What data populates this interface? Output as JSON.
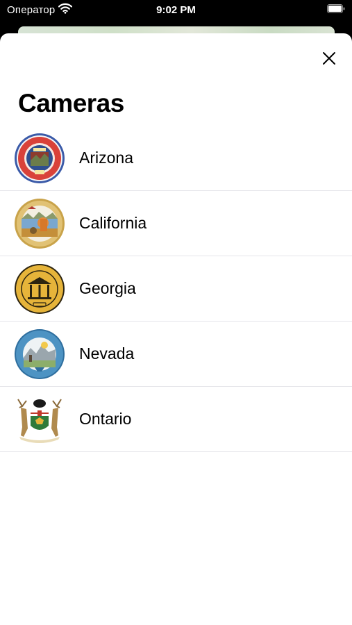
{
  "status_bar": {
    "carrier": "Оператор",
    "time": "9:02 PM"
  },
  "sheet": {
    "title": "Cameras",
    "close_icon": "close-icon"
  },
  "states": [
    {
      "label": "Arizona",
      "seal": "arizona-seal-icon",
      "seal_text": "DITAT DEUS",
      "seal_year": "1912"
    },
    {
      "label": "California",
      "seal": "california-seal-icon",
      "seal_text": "EUREKA"
    },
    {
      "label": "Georgia",
      "seal": "georgia-seal-icon",
      "seal_year": "1776"
    },
    {
      "label": "Nevada",
      "seal": "nevada-seal-icon"
    },
    {
      "label": "Ontario",
      "seal": "ontario-coat-of-arms-icon"
    }
  ],
  "colors": {
    "sheet_background": "#ffffff",
    "separator": "#e5e5ea",
    "status_bar_background": "#000000"
  }
}
